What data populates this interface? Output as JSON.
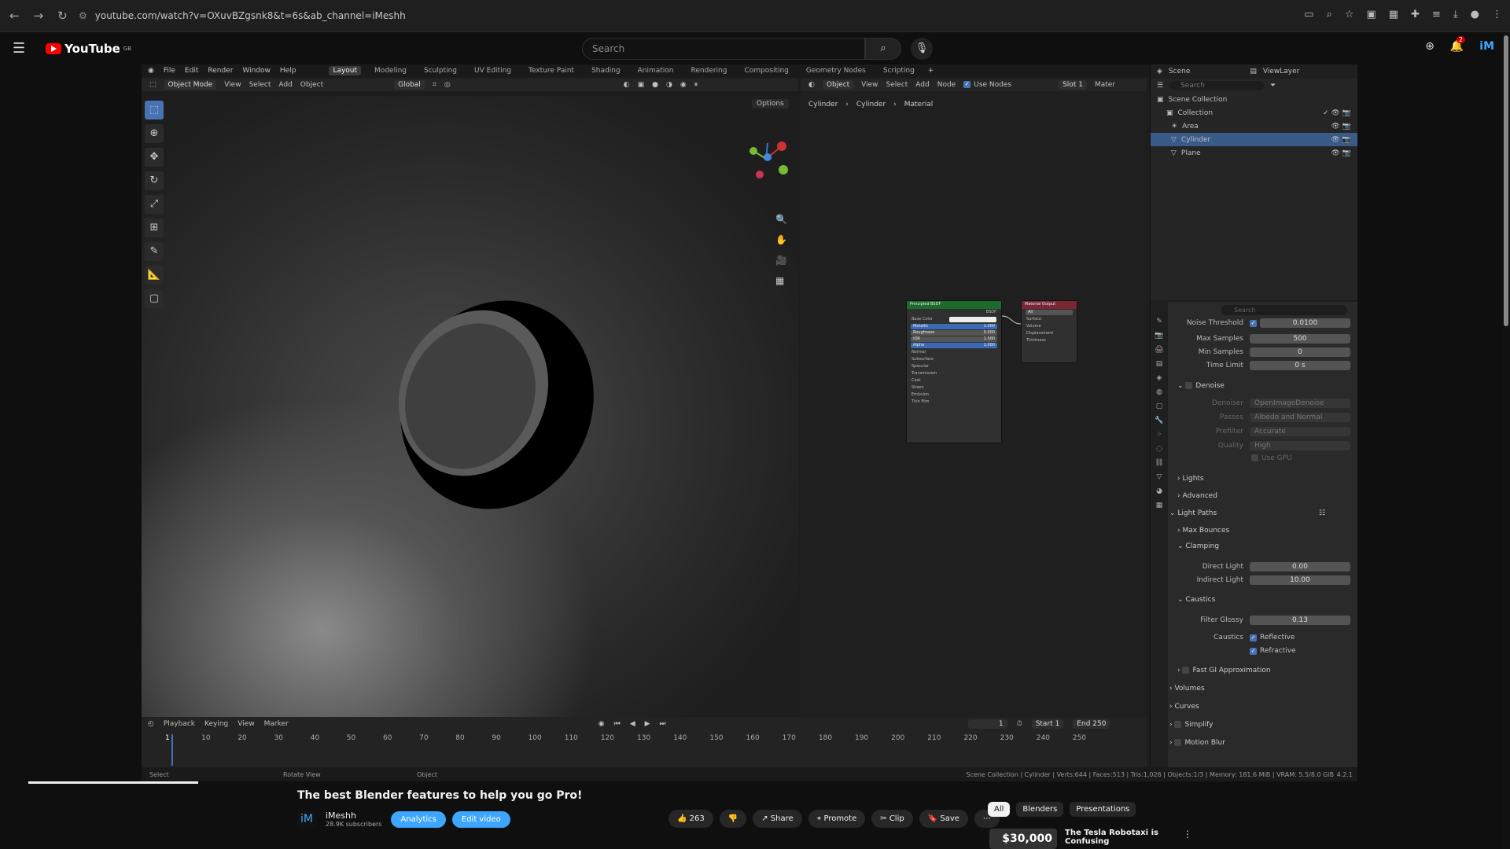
{
  "browser": {
    "url": "youtube.com/watch?v=OXuvBZgsnk8&t=6s&ab_channel=iMeshh"
  },
  "youtube": {
    "logo": "YouTube",
    "logo_sup": "GB",
    "search_placeholder": "Search",
    "notif_count": "2"
  },
  "blender": {
    "menus": [
      "File",
      "Edit",
      "Render",
      "Window",
      "Help"
    ],
    "workspaces": [
      "Layout",
      "Modeling",
      "Sculpting",
      "UV Editing",
      "Texture Paint",
      "Shading",
      "Animation",
      "Rendering",
      "Compositing",
      "Geometry Nodes",
      "Scripting"
    ],
    "active_workspace": "Layout",
    "viewport_header": {
      "mode": "Object Mode",
      "items": [
        "View",
        "Select",
        "Add",
        "Object"
      ],
      "transform": "Global",
      "options": "Options"
    },
    "node_header": {
      "object": "Object",
      "items": [
        "View",
        "Select",
        "Add",
        "Node"
      ],
      "use_nodes": "Use Nodes",
      "slot": "Slot 1",
      "material": "Mater"
    },
    "breadcrumb": [
      "Cylinder",
      "Cylinder",
      "Material"
    ],
    "bsdf_node": {
      "title": "Principled BSDF",
      "out": "BSDF",
      "rows": [
        {
          "l": "Base Color",
          "v": ""
        },
        {
          "l": "Metallic",
          "v": "1.000"
        },
        {
          "l": "Roughness",
          "v": "0.000"
        },
        {
          "l": "IOR",
          "v": "1.500"
        },
        {
          "l": "Alpha",
          "v": "1.000"
        }
      ],
      "subs": [
        "Normal",
        "Subsurface",
        "Specular",
        "Transmission",
        "Coat",
        "Sheen",
        "Emission",
        "Thin Film"
      ]
    },
    "out_node": {
      "title": "Material Output",
      "target": "All",
      "rows": [
        "Surface",
        "Volume",
        "Displacement",
        "Thickness"
      ]
    },
    "outliner": {
      "scene": "Scene",
      "viewlayer": "ViewLayer",
      "search": "Search",
      "root": "Scene Collection",
      "items": [
        "Collection",
        "Area",
        "Cylinder",
        "Plane"
      ],
      "selected": "Cylinder"
    },
    "props": {
      "search": "Search",
      "noise_threshold": {
        "label": "Noise Threshold",
        "value": "0.0100"
      },
      "max_samples": {
        "label": "Max Samples",
        "value": "500"
      },
      "min_samples": {
        "label": "Min Samples",
        "value": "0"
      },
      "time_limit": {
        "label": "Time Limit",
        "value": "0 s"
      },
      "denoise": "Denoise",
      "denoiser": {
        "label": "Denoiser",
        "value": "OpenImageDenoise"
      },
      "passes": {
        "label": "Passes",
        "value": "Albedo and Normal"
      },
      "prefilter": {
        "label": "Prefilter",
        "value": "Accurate"
      },
      "quality": {
        "label": "Quality",
        "value": "High"
      },
      "use_gpu": "Use GPU",
      "lights": "Lights",
      "advanced": "Advanced",
      "light_paths": "Light Paths",
      "max_bounces": "Max Bounces",
      "clamping": "Clamping",
      "direct_light": {
        "label": "Direct Light",
        "value": "0.00"
      },
      "indirect_light": {
        "label": "Indirect Light",
        "value": "10.00"
      },
      "caustics_sect": "Caustics",
      "filter_glossy": {
        "label": "Filter Glossy",
        "value": "0.13"
      },
      "caustics_label": "Caustics",
      "reflective": "Reflective",
      "refractive": "Refractive",
      "fast_gi": "Fast GI Approximation",
      "volumes": "Volumes",
      "curves": "Curves",
      "simplify": "Simplify",
      "motion_blur": "Motion Blur"
    },
    "timeline": {
      "items": [
        "Playback",
        "Keying",
        "View",
        "Marker"
      ],
      "current": "1",
      "start_label": "Start",
      "start": "1",
      "end_label": "End",
      "end": "250",
      "frames": [
        "1",
        "10",
        "20",
        "30",
        "40",
        "50",
        "60",
        "70",
        "80",
        "90",
        "100",
        "110",
        "120",
        "130",
        "140",
        "150",
        "160",
        "170",
        "180",
        "190",
        "200",
        "210",
        "220",
        "230",
        "240",
        "250"
      ]
    },
    "status": {
      "select": "Select",
      "rotate": "Rotate View",
      "object": "Object",
      "info": "Scene Collection | Cylinder | Verts:644 | Faces:513 | Tris:1,026 | Objects:1/3 | Memory: 181.6 MiB | VRAM: 5.5/8.0 GiB",
      "version": "4.2.1"
    }
  },
  "video": {
    "title": "The best Blender features to help you go Pro!",
    "channel": "iMeshh",
    "subs": "28.9K subscribers",
    "analytics": "Analytics",
    "edit": "Edit video",
    "likes": "263",
    "share": "Share",
    "promote": "Promote",
    "clip": "Clip",
    "save": "Save"
  },
  "chips": [
    "All",
    "Blenders",
    "Presentations"
  ],
  "rec": {
    "thumb": "$30,000",
    "title": "The Tesla Robotaxi is Confusing"
  }
}
